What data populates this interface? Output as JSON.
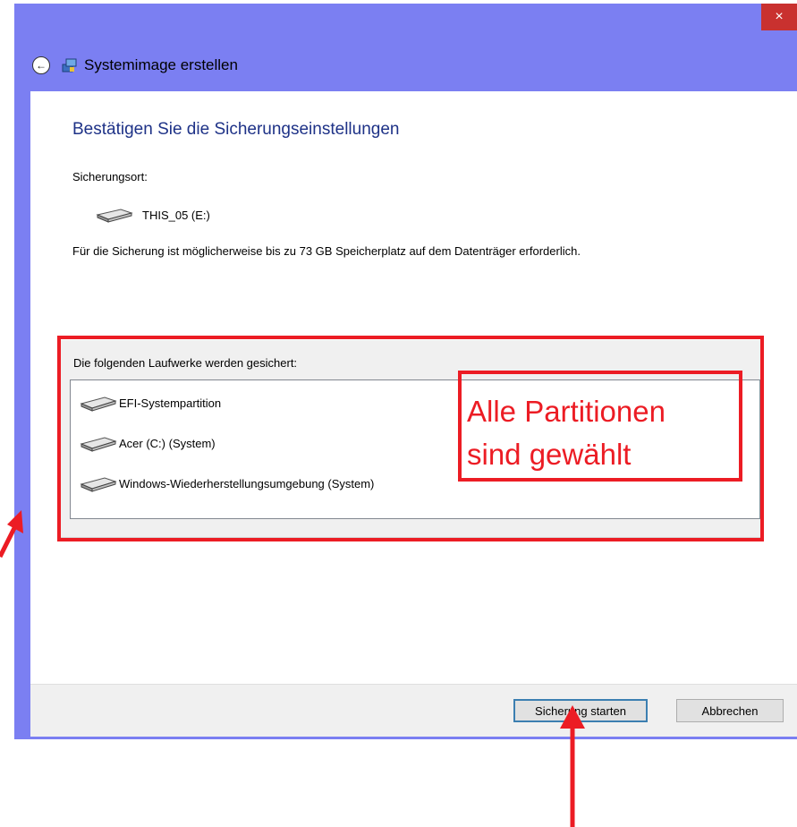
{
  "window": {
    "title": "Systemimage erstellen",
    "close_label": "×"
  },
  "content": {
    "heading": "Bestätigen Sie die Sicherungseinstellungen",
    "location_label": "Sicherungsort:",
    "location_drive": "THIS_05 (E:)",
    "space_note": "Für die Sicherung ist möglicherweise bis zu 73 GB Speicherplatz auf dem Datenträger erforderlich."
  },
  "drives_group": {
    "label": "Die folgenden Laufwerke werden gesichert:",
    "items": [
      {
        "label": "EFI-Systempartition"
      },
      {
        "label": "Acer (C:) (System)"
      },
      {
        "label": "Windows-Wiederherstellungsumgebung (System)"
      }
    ]
  },
  "annotation": {
    "line1": "Alle Partitionen",
    "line2": "sind gewählt"
  },
  "footer": {
    "start_label": "Sicherung starten",
    "cancel_label": "Abbrechen"
  },
  "colors": {
    "titlebar": "#7b7ff2",
    "annotation_red": "#ec1c24",
    "heading_blue": "#1e3287"
  }
}
